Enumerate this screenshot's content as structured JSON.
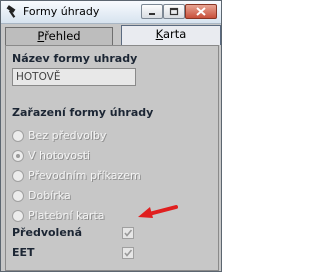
{
  "window": {
    "title": "Formy úhrady"
  },
  "tabs": [
    {
      "label_prefix": "",
      "label_underlined": "P",
      "label_rest": "řehled"
    },
    {
      "label_prefix": "",
      "label_underlined": "K",
      "label_rest": "arta"
    }
  ],
  "form": {
    "name_label": "Název formy uhrady",
    "name_value": "HOTOVĚ",
    "classification_label": "Zařazení formy úhrady",
    "options": [
      {
        "label": "Bez předvolby",
        "checked": false
      },
      {
        "label": "V hotovosti",
        "checked": true
      },
      {
        "label": "Převodním příkazem",
        "checked": false
      },
      {
        "label": "Dobírka",
        "checked": false
      },
      {
        "label": "Platební karta",
        "checked": false
      }
    ],
    "default_label": "Předvolená",
    "default_checked": true,
    "eet_label": "EET",
    "eet_checked": true
  },
  "colors": {
    "arrow": "#e01f1f",
    "section_text": "#1c2634"
  },
  "icons": {
    "app": "hammer-icon",
    "minimize": "minimize-icon",
    "maximize": "maximize-icon",
    "close": "close-icon",
    "annotation": "red-arrow-icon"
  }
}
